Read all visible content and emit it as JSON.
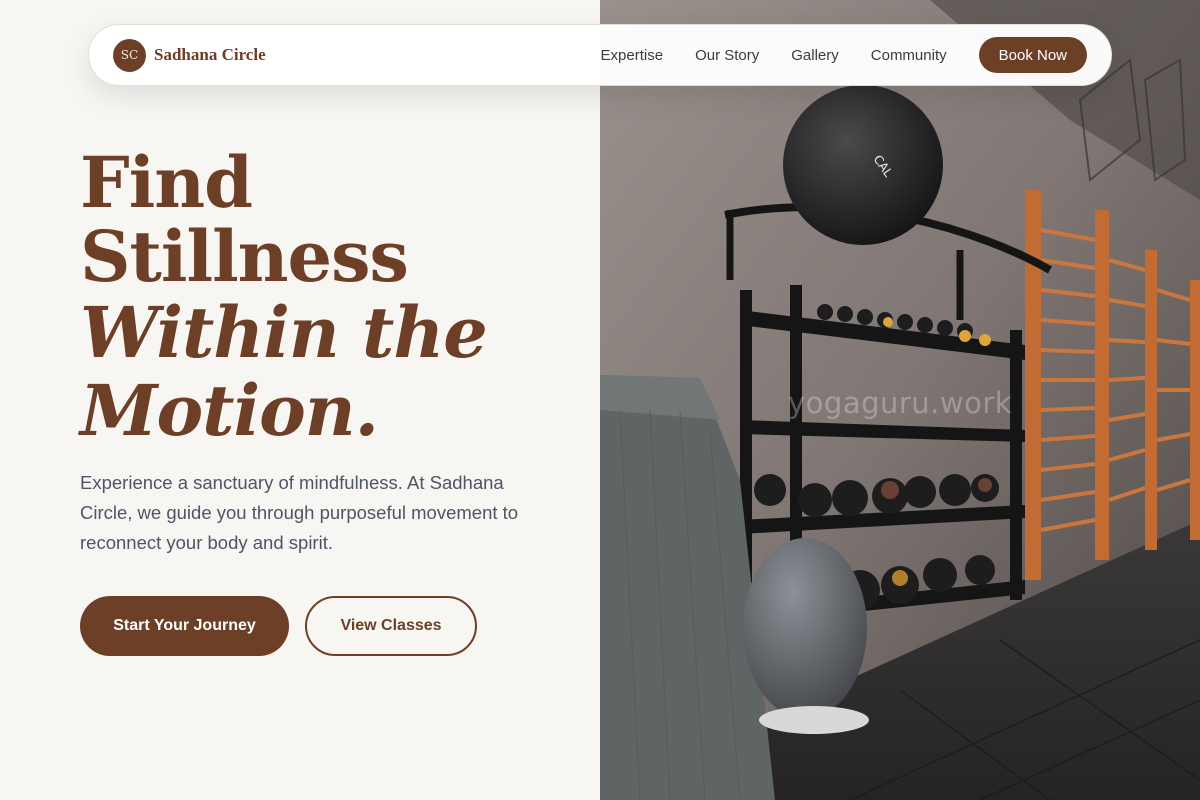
{
  "nav": {
    "logo_initials": "SC",
    "brand_name": "Sadhana Circle",
    "links": [
      "Expertise",
      "Our Story",
      "Gallery",
      "Community"
    ],
    "cta_label": "Book Now"
  },
  "hero": {
    "title_line1": "Find",
    "title_line2": "Stillness",
    "title_line3": "Within the",
    "title_line4": "Motion.",
    "description": "Experience a sanctuary of mindfulness. At Sadhana Circle, we guide you through purposeful movement to reconnect your body and spirit.",
    "primary_button": "Start Your Journey",
    "secondary_button": "View Classes"
  },
  "image": {
    "subject": "gym-interior-photo",
    "watermark": "yogaguru.work"
  },
  "colors": {
    "brand": "#6d3f26",
    "background": "#f8f6f3",
    "body_text": "#4d5566"
  }
}
